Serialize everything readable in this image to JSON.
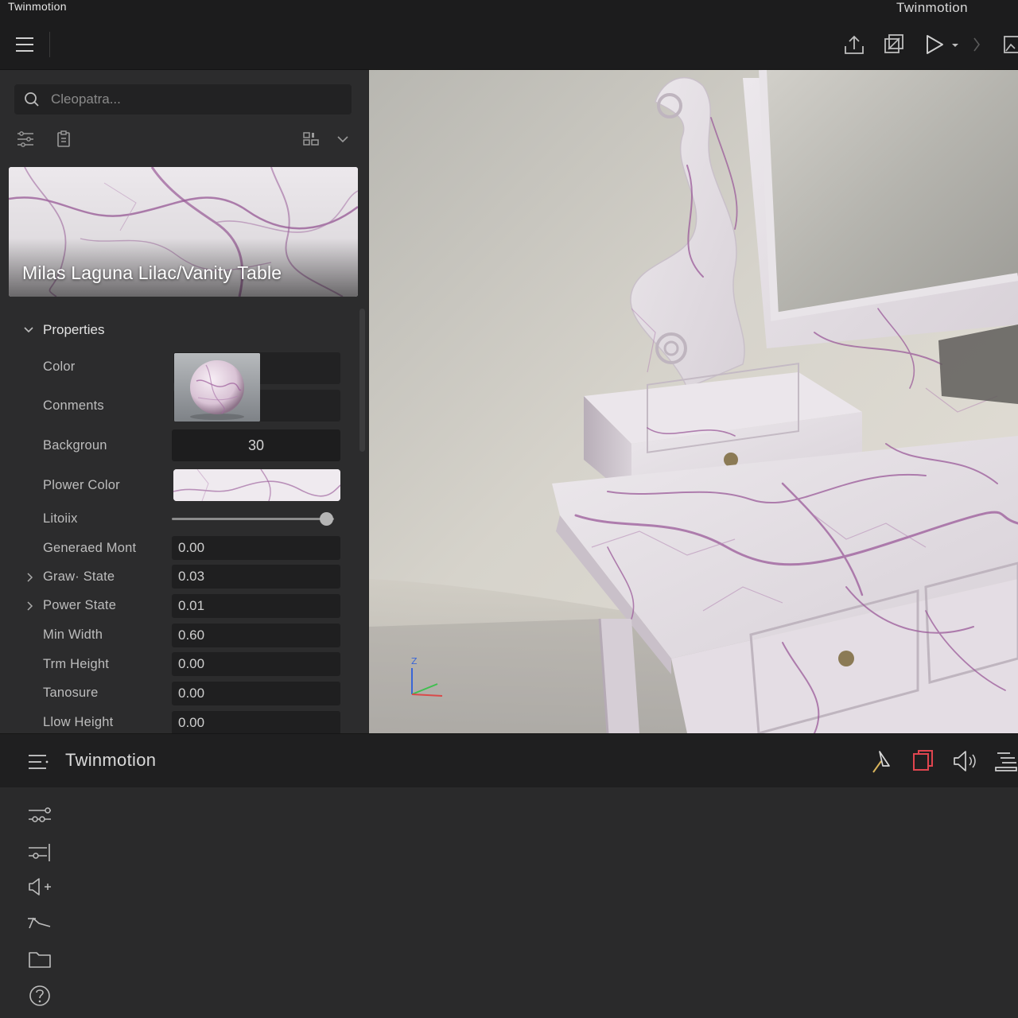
{
  "app": {
    "title_left": "Twinmotion",
    "title_right": "Twinmotion"
  },
  "toolbar": {
    "icons": [
      "menu-icon",
      "export-icon",
      "render-icon",
      "play-icon",
      "dropdown-icon",
      "chevron-right-icon",
      "image-icon"
    ]
  },
  "search": {
    "placeholder": "Cleopatra..."
  },
  "material": {
    "title": "Milas Laguna Lilac/Vanity Table",
    "accent": "#9b5b9a"
  },
  "properties": {
    "section_label": "Properties",
    "rows": [
      {
        "label": "Color"
      },
      {
        "label": "Conments"
      },
      {
        "label": "Backgroun",
        "value": "30"
      },
      {
        "label": "Plower Color"
      },
      {
        "label": "Litoiix",
        "slider_fraction": 0.95
      },
      {
        "label": "Generaed Mont",
        "value": "0.00"
      },
      {
        "label": "Graw· State",
        "value": "0.03"
      },
      {
        "label": "Power State",
        "value": "0.01"
      },
      {
        "label": "Min Width",
        "value": "0.60"
      },
      {
        "label": "Trm Height",
        "value": "0.00"
      },
      {
        "label": "Tanosure",
        "value": "0.00"
      },
      {
        "label": "Llow Height",
        "value": "0.00"
      }
    ]
  },
  "viewport": {
    "axis_label": "Z"
  },
  "bottom_bar": {
    "title": "Twinmotion",
    "highlight_color": "#e0454f"
  },
  "side_icons": [
    "settings-icon",
    "adjust-icon",
    "speaker-add-icon",
    "path-icon",
    "folder-icon",
    "help-icon"
  ]
}
